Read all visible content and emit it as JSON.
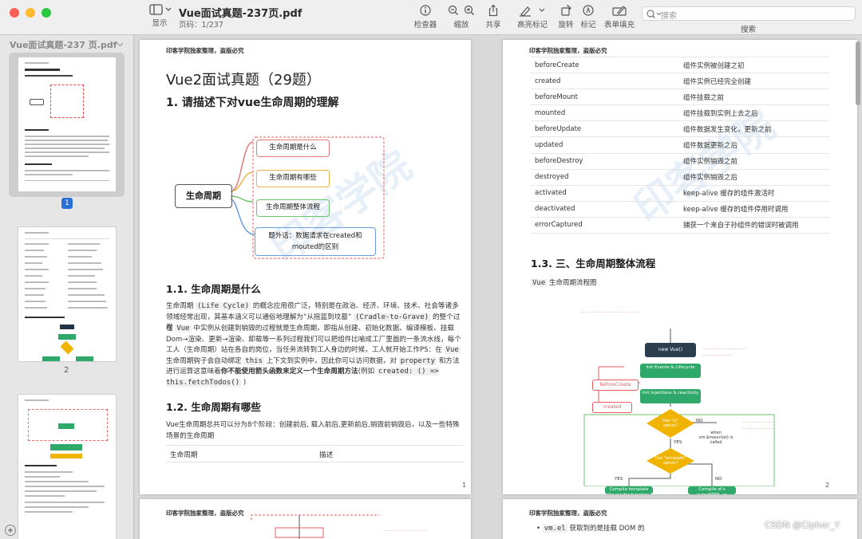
{
  "window": {
    "title": "Vue面试真题-237页.pdf",
    "subtitle": "页码：1/237"
  },
  "toolbar": {
    "display": "显示",
    "inspector": "检查器",
    "zoom": "缩放",
    "share": "共享",
    "highlight": "高亮标记",
    "rotate": "旋转",
    "markup": "标记",
    "form": "表单填充",
    "search_label": "搜索",
    "search_placeholder": "搜索"
  },
  "sidebar": {
    "title": "Vue面试真题-237 页.pdf",
    "thumbs": [
      {
        "num": "1"
      },
      {
        "num": "2"
      }
    ]
  },
  "page1": {
    "header": "印客学院独家整理，盗版必究",
    "h1": "Vue2面试真题（29题）",
    "h2": "1. 请描述下对vue生命周期的理解",
    "mind": {
      "center": "生命周期",
      "b1": "生命周期是什么",
      "b2": "生命周期有哪些",
      "b3": "生命周期整体流程",
      "b4": "题外话：数据请求在created和mouted的区别"
    },
    "s11": "1.1. 生命周期是什么",
    "p1a": "生命周期",
    "p1b": "(Life Cycle)",
    "p1c": "的概念应用很广泛，特别是在政治、经济、环境、技术、社会等诸多领域经常出现，其基本涵义可以通俗地理解为“从摇篮到坟墓”",
    "p1d": "(Cradle-to-Grave)",
    "p1e": "的整个过程",
    "p2a": "在",
    "p2b": "Vue",
    "p2c": "中实例从创建到销毁的过程就是生命周期，即指从创建、初始化数据、编译模板、挂载Dom→渲染、更新→渲染、卸载等一系列过程我们可以把组件比喻成工厂里面的一条流水线，每个工人（生命周期）站在各自的岗位，当任务流转到工人身边的时候，工人就开始工作PS：在",
    "p2d": "Vue",
    "p2e": "生命周期钩子会自动绑定",
    "p2f": "this",
    "p2g": "上下文到实例中，因此你可以访问数据，对",
    "p2h": "property",
    "p2i": "和方法进行运算这意味着",
    "p2j": "你不能使用箭头函数来定义一个生命周期方法",
    "p2k": "(例如",
    "p2l": "created: () => this.fetchTodos()",
    "p2m": ")",
    "s12": "1.2. 生命周期有哪些",
    "p3": "Vue生命周期总共可以分为8个阶段：创建前后, 载入前后,更新前后,销毁前销毁后，以及一些特殊场景的生命周期",
    "th1": "生命周期",
    "th2": "描述",
    "pnum": "1",
    "watermark": "印客学院"
  },
  "page2": {
    "header": "印客学院独家整理，盗版必究",
    "rows": [
      [
        "beforeCreate",
        "组件实例被创建之初"
      ],
      [
        "created",
        "组件实例已经完全创建"
      ],
      [
        "beforeMount",
        "组件挂载之前"
      ],
      [
        "mounted",
        "组件挂载到实例上去之后"
      ],
      [
        "beforeUpdate",
        "组件数据发生变化，更新之前"
      ],
      [
        "updated",
        "组件数据更新之后"
      ],
      [
        "beforeDestroy",
        "组件实例销毁之前"
      ],
      [
        "destroyed",
        "组件实例销毁之后"
      ],
      [
        "activated",
        "keep-alive 缓存的组件激活时"
      ],
      [
        "deactivated",
        "keep-alive 缓存的组件停用时调用"
      ],
      [
        "errorCaptured",
        "捕获一个来自子孙组件的错误时被调用"
      ]
    ],
    "s13": "1.3. 三、生命周期整体流程",
    "flowcap_code": "Vue",
    "flowcap": "生命周期流程图",
    "flow": {
      "newvue": "new Vue()",
      "init1": "Init Events & Lifecycle",
      "beforecreate": "beforeCreate",
      "init2": "Init injections & reactivity",
      "created": "created",
      "d1": "Has \"el\" option?",
      "d2": "Has \"template\" option?",
      "no": "NO",
      "yes": "YES",
      "when": "when vm.$mount(el) is called",
      "c1": "Compile template into render function *",
      "c2": "Compile el's outerHTML as template *"
    },
    "pnum": "2",
    "watermark": "印客学院"
  },
  "page3": {
    "header": "印客学院独家整理，盗版必究"
  },
  "page4": {
    "header": "印客学院独家整理，盗版必究",
    "bullet_code": "vm.el",
    "bullet_text": "获取到的是挂载 DOM 的"
  },
  "credit": "CSDN @Cipher_Y"
}
